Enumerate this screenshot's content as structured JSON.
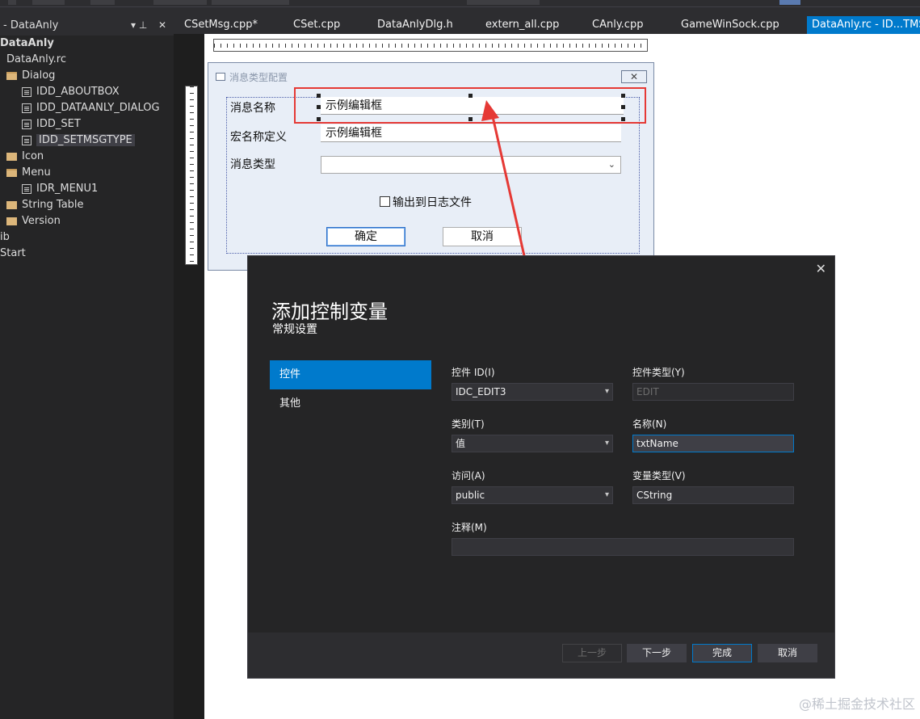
{
  "explorer": {
    "title": "- DataAnly",
    "pin": "▾ ⊥",
    "close": "✕",
    "items": [
      {
        "label": "DataAnly"
      },
      {
        "label": "DataAnly.rc"
      },
      {
        "label": "Dialog"
      },
      {
        "label": "IDD_ABOUTBOX"
      },
      {
        "label": "IDD_DATAANLY_DIALOG"
      },
      {
        "label": "IDD_SET"
      },
      {
        "label": "IDD_SETMSGTYPE"
      },
      {
        "label": "Icon"
      },
      {
        "label": "Menu"
      },
      {
        "label": "IDR_MENU1"
      },
      {
        "label": "String Table"
      },
      {
        "label": "Version"
      },
      {
        "label": "ib"
      },
      {
        "label": "Start"
      }
    ]
  },
  "tabs": [
    {
      "label": "CSetMsg.cpp*"
    },
    {
      "label": "CSet.cpp"
    },
    {
      "label": "DataAnlyDlg.h"
    },
    {
      "label": "extern_all.cpp"
    },
    {
      "label": "CAnly.cpp"
    },
    {
      "label": "GameWinSock.cpp"
    },
    {
      "label": "DataAnly.rc - ID...TMSG"
    }
  ],
  "design_dialog": {
    "title": "消息类型配置",
    "close": "✕",
    "msg_name_label": "消息名称",
    "msg_name_value": "示例编辑框",
    "macro_label": "宏名称定义",
    "macro_value": "示例编辑框",
    "type_label": "消息类型",
    "type_arrow": "⌄",
    "log_checkbox": "输出到日志文件",
    "ok": "确定",
    "cancel": "取消"
  },
  "wizard": {
    "close": "✕",
    "title": "添加控制变量",
    "subtitle": "常规设置",
    "nav": [
      {
        "label": "控件"
      },
      {
        "label": "其他"
      }
    ],
    "control_id_label": "控件 ID(I)",
    "control_id_value": "IDC_EDIT3",
    "control_type_label": "控件类型(Y)",
    "control_type_value": "EDIT",
    "category_label": "类别(T)",
    "category_value": "值",
    "name_label": "名称(N)",
    "name_value": "txtName",
    "access_label": "访问(A)",
    "access_value": "public",
    "var_type_label": "变量类型(V)",
    "var_type_value": "CString",
    "comment_label": "注释(M)",
    "comment_value": "",
    "dropdown_arrow": "▾",
    "buttons": {
      "prev": "上一步",
      "next": "下一步",
      "finish": "完成",
      "cancel": "取消"
    }
  },
  "watermark": "@稀土掘金技术社区",
  "colors": {
    "accent": "#007acc",
    "annotation": "#e53935"
  }
}
